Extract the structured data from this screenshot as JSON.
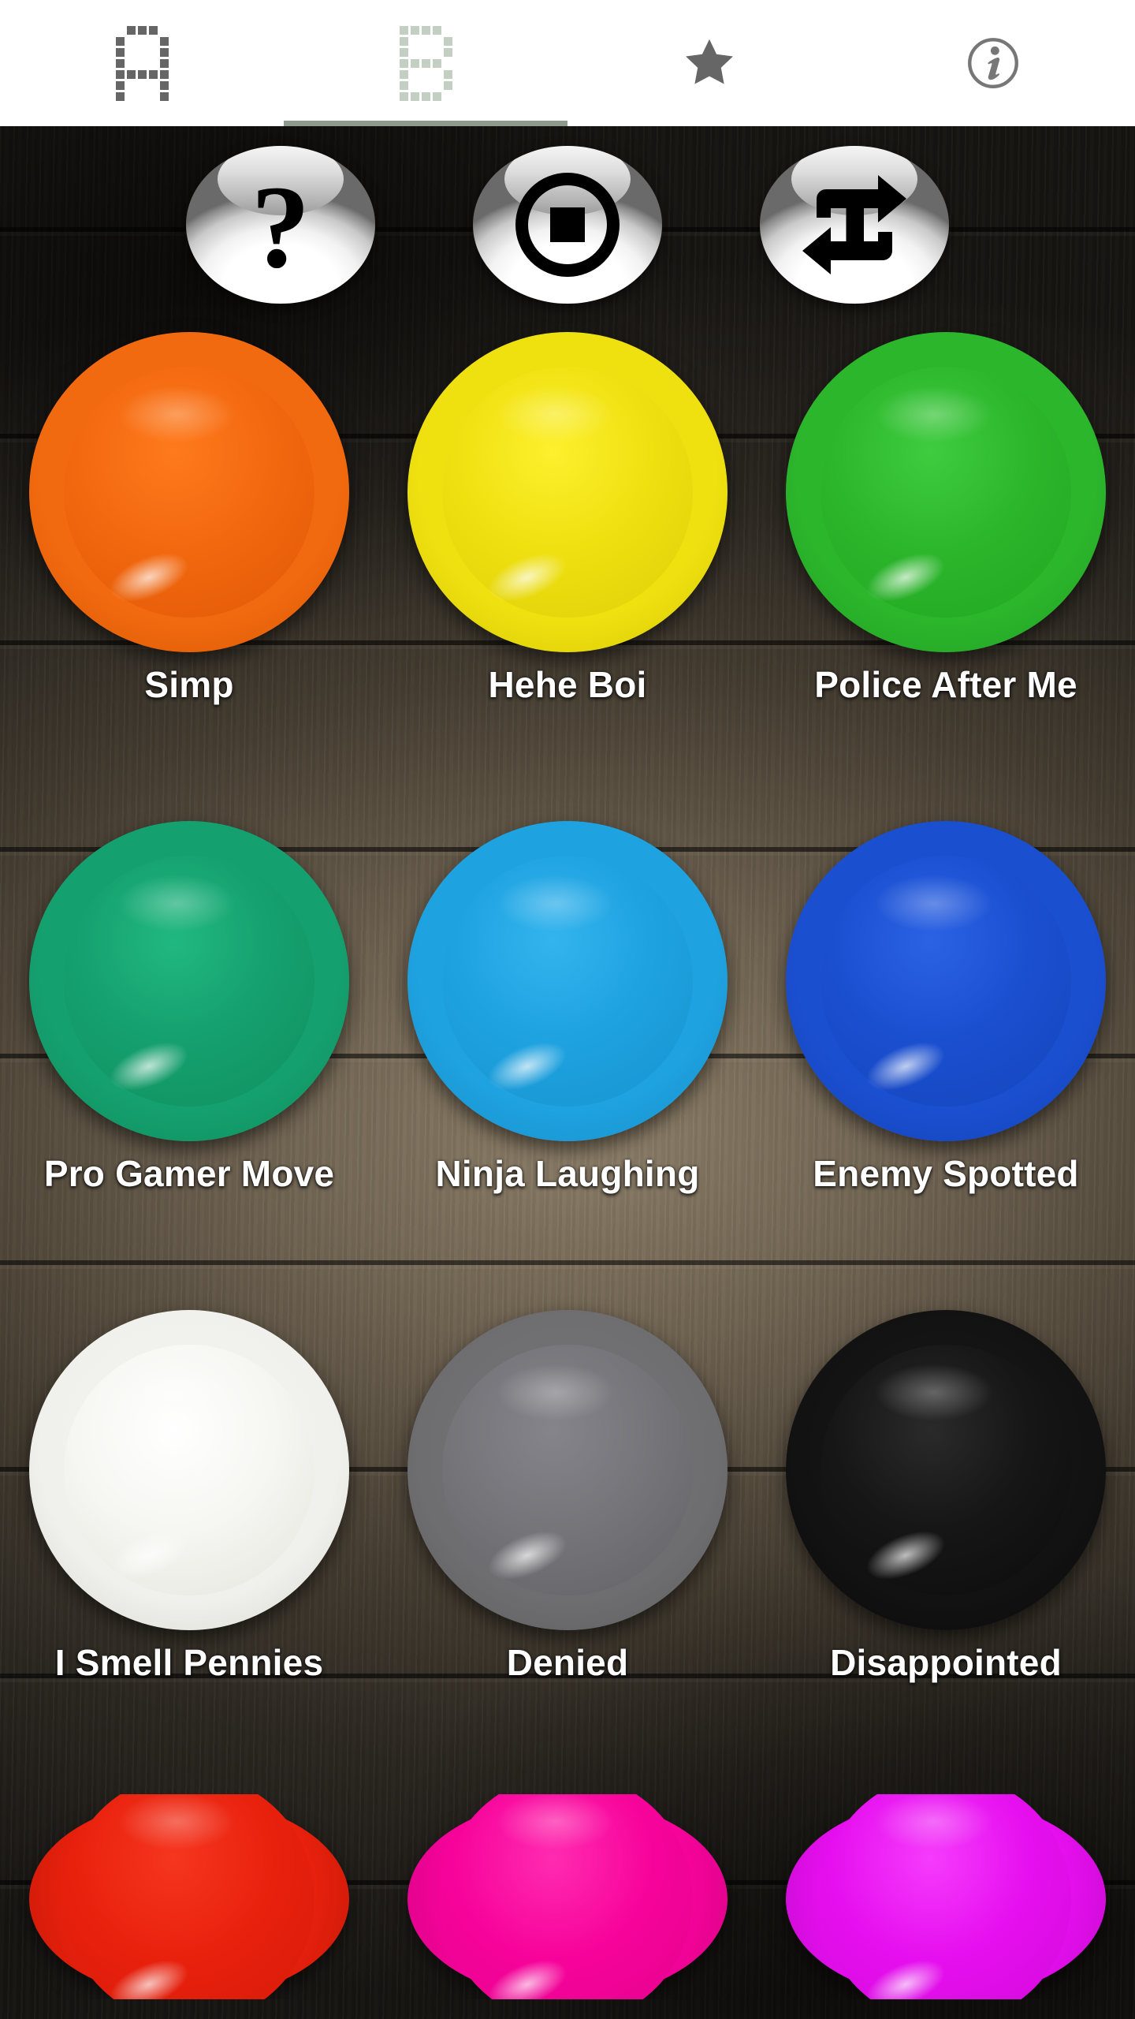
{
  "app": {
    "background": "dark-wood-planks",
    "background_color": "#453d31"
  },
  "tabbar": {
    "background": "#ffffff",
    "active_indicator_color": "#8d9b8c",
    "tabs": [
      {
        "id": "tab-a",
        "icon": "pixel-letter-a-icon",
        "label": "A",
        "active": false,
        "color": "#666666"
      },
      {
        "id": "tab-b",
        "icon": "pixel-letter-b-icon",
        "label": "B",
        "active": true,
        "color": "#c3cfc2"
      },
      {
        "id": "tab-favorites",
        "icon": "star-icon",
        "label": "Favorites",
        "active": false,
        "color": "#666666"
      },
      {
        "id": "tab-info",
        "icon": "info-circle-icon",
        "label": "Info",
        "active": false,
        "color": "#777777"
      }
    ]
  },
  "controls": [
    {
      "id": "random-button",
      "icon": "question-mark-icon",
      "label": "?"
    },
    {
      "id": "stop-button",
      "icon": "stop-icon",
      "label": "Stop"
    },
    {
      "id": "repeat-button",
      "icon": "repeat-icon",
      "label": "Repeat"
    }
  ],
  "soundboard": {
    "rows": [
      [
        {
          "label": "Simp",
          "color": "#f2680f",
          "rim": "#e35c07",
          "name": "sound-button-simp"
        },
        {
          "label": "Hehe Boi",
          "color": "#efe010",
          "rim": "#e2d209",
          "name": "sound-button-hehe-boi"
        },
        {
          "label": "Police After Me",
          "color": "#2cb62c",
          "rim": "#24a524",
          "name": "sound-button-police-after-me"
        }
      ],
      [
        {
          "label": "Pro Gamer Move",
          "color": "#15a06f",
          "rim": "#139364",
          "name": "sound-button-pro-gamer-move"
        },
        {
          "label": "Ninja Laughing",
          "color": "#1ea2e0",
          "rim": "#1b94cd",
          "name": "sound-button-ninja-laughing"
        },
        {
          "label": "Enemy Spotted",
          "color": "#1a4fd0",
          "rim": "#1746be",
          "name": "sound-button-enemy-spotted"
        }
      ],
      [
        {
          "label": "I Smell Pennies",
          "color": "#f0f0ec",
          "rim": "#e2e2dd",
          "name": "sound-button-i-smell-pennies"
        },
        {
          "label": "Denied",
          "color": "#6e6e70",
          "rim": "#646466",
          "name": "sound-button-denied"
        },
        {
          "label": "Disappointed",
          "color": "#121212",
          "rim": "#0a0a0a",
          "name": "sound-button-disappointed"
        }
      ],
      [
        {
          "label": "",
          "color": "#e8210d",
          "rim": "#d31c0a",
          "name": "sound-button-red"
        },
        {
          "label": "",
          "color": "#f7039b",
          "rim": "#e2038e",
          "name": "sound-button-pink"
        },
        {
          "label": "",
          "color": "#e60fef",
          "rim": "#d30cdb",
          "name": "sound-button-magenta"
        }
      ]
    ]
  }
}
